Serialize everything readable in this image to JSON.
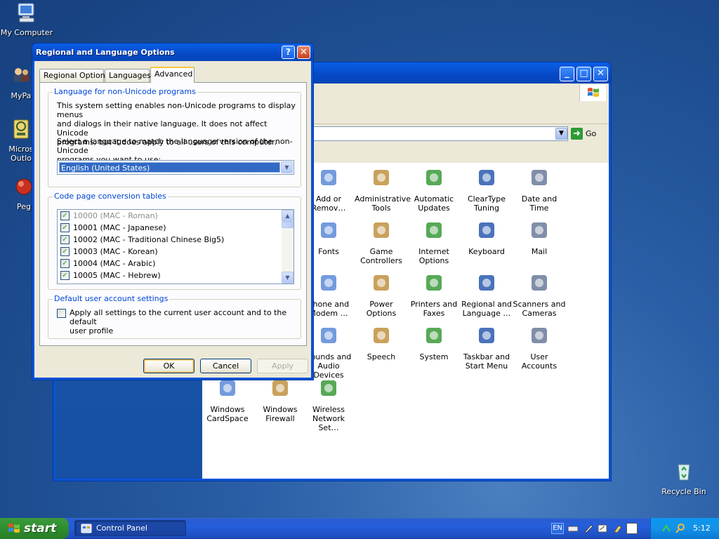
{
  "desktop": {
    "icons": [
      {
        "label": "My Computer"
      },
      {
        "label": "MyPa"
      },
      {
        "label": "Micros Outlo"
      },
      {
        "label": "Peg"
      },
      {
        "label": "Recycle Bin"
      }
    ]
  },
  "control_panel": {
    "address_go_label": "Go",
    "items": [
      {
        "label": "Add or Remov…",
        "icon": "add-remove-programs-icon"
      },
      {
        "label": "Administrative Tools",
        "icon": "administrative-tools-icon"
      },
      {
        "label": "Automatic Updates",
        "icon": "automatic-updates-icon"
      },
      {
        "label": "ClearType Tuning",
        "icon": "cleartype-icon"
      },
      {
        "label": "Date and Time",
        "icon": "date-time-icon"
      },
      {
        "label": "Fonts",
        "icon": "fonts-folder-icon"
      },
      {
        "label": "Game Controllers",
        "icon": "game-controller-icon"
      },
      {
        "label": "Internet Options",
        "icon": "internet-options-icon"
      },
      {
        "label": "Keyboard",
        "icon": "keyboard-icon"
      },
      {
        "label": "Mail",
        "icon": "mail-icon"
      },
      {
        "label": "Phone and Modem …",
        "icon": "phone-modem-icon"
      },
      {
        "label": "Power Options",
        "icon": "power-options-icon"
      },
      {
        "label": "Printers and Faxes",
        "icon": "printer-icon"
      },
      {
        "label": "Regional and Language …",
        "icon": "globe-icon"
      },
      {
        "label": "Scanners and Cameras",
        "icon": "scanner-camera-icon"
      },
      {
        "label": "Sounds and Audio Devices",
        "icon": "speaker-icon"
      },
      {
        "label": "Speech",
        "icon": "speech-icon"
      },
      {
        "label": "System",
        "icon": "system-icon"
      },
      {
        "label": "Taskbar and Start Menu",
        "icon": "taskbar-icon"
      },
      {
        "label": "User Accounts",
        "icon": "user-accounts-icon"
      },
      {
        "label": "Windows CardSpace",
        "icon": "cardspace-icon"
      },
      {
        "label": "Windows Firewall",
        "icon": "firewall-icon"
      },
      {
        "label": "Wireless Network Set…",
        "icon": "wireless-icon"
      }
    ]
  },
  "dialog": {
    "title": "Regional and Language Options",
    "help_glyph": "?",
    "close_glyph": "✕",
    "tabs": [
      {
        "label": "Regional Options"
      },
      {
        "label": "Languages"
      },
      {
        "label": "Advanced"
      }
    ],
    "non_unicode": {
      "legend": "Language for non-Unicode programs",
      "desc": [
        "This system setting enables non-Unicode programs to display menus",
        "and dialogs in their native language. It does not affect Unicode",
        "programs, but it does apply to all users of this computer."
      ],
      "select_prompt": [
        "Select a language to match the language version of the non-Unicode",
        "programs you want to use:"
      ],
      "selected_language": "English (United States)"
    },
    "code_pages": {
      "legend": "Code page conversion tables",
      "items": [
        {
          "label": "10000 (MAC - Roman)",
          "checked": true,
          "dim": true
        },
        {
          "label": "10001 (MAC - Japanese)",
          "checked": true,
          "dim": false
        },
        {
          "label": "10002 (MAC - Traditional Chinese Big5)",
          "checked": true,
          "dim": false
        },
        {
          "label": "10003 (MAC - Korean)",
          "checked": true,
          "dim": false
        },
        {
          "label": "10004 (MAC - Arabic)",
          "checked": true,
          "dim": false
        },
        {
          "label": "10005 (MAC - Hebrew)",
          "checked": true,
          "dim": false
        }
      ]
    },
    "default_user": {
      "legend": "Default user account settings",
      "checkbox_label": [
        "Apply all settings to the current user account and to the default",
        "user profile"
      ]
    },
    "buttons": {
      "ok": "OK",
      "cancel": "Cancel",
      "apply": "Apply"
    }
  },
  "taskbar": {
    "start_label": "start",
    "task_label": "Control Panel",
    "language_indicator": "EN",
    "clock": "5:12"
  },
  "colors": {
    "xp_blue": "#0a52d8",
    "dialog_face": "#ece9d8",
    "group_legend": "#0046d5",
    "selection": "#316ac5"
  }
}
